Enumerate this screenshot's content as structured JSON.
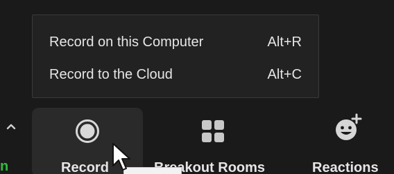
{
  "menu": {
    "items": [
      {
        "label": "Record on this Computer",
        "shortcut": "Alt+R"
      },
      {
        "label": "Record to the Cloud",
        "shortcut": "Alt+C"
      }
    ]
  },
  "toolbar": {
    "left_fragment": "n",
    "record": {
      "label": "Record",
      "icon": "record-icon"
    },
    "breakout": {
      "label": "Breakout Rooms",
      "icon": "breakout-rooms-icon"
    },
    "reactions": {
      "label": "Reactions",
      "icon": "reactions-icon"
    }
  },
  "colors": {
    "background": "#1a1a1a",
    "menu_background": "#222222",
    "text": "#e6e6e6",
    "green": "#2fbf3a",
    "icon_gray": "#cfcfcf"
  }
}
